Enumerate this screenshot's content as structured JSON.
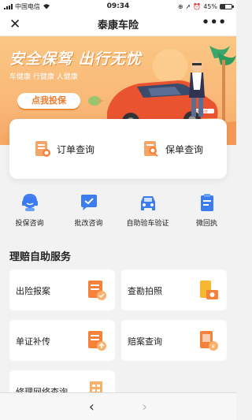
{
  "status_bar": {
    "carrier": "中国电信",
    "time": "09:34",
    "battery": "45%",
    "battery_level": 0.45
  },
  "nav": {
    "close_glyph": "✕",
    "title": "泰康车险",
    "more_glyph": "•••"
  },
  "banner": {
    "title": "安全保驾 出行无忧",
    "subtitle": "车健康  行健康  人健康",
    "cta": "点我投保",
    "car_plate": "保驾无忧"
  },
  "query": [
    {
      "label": "订单查询",
      "icon": "order-doc-icon"
    },
    {
      "label": "保单查询",
      "icon": "policy-search-icon"
    }
  ],
  "quick_services": [
    {
      "label": "投保咨询",
      "icon": "customer-service-icon"
    },
    {
      "label": "批改咨询",
      "icon": "chat-check-icon"
    },
    {
      "label": "自助验车验证",
      "icon": "car-icon"
    },
    {
      "label": "微回执",
      "icon": "clipboard-icon"
    }
  ],
  "section": {
    "title": "理赔自助服务"
  },
  "claims": [
    {
      "label": "出险报案",
      "icon": "report-doc-icon"
    },
    {
      "label": "查勘拍照",
      "icon": "camera-doc-icon"
    },
    {
      "label": "单证补传",
      "icon": "upload-doc-icon"
    },
    {
      "label": "赔案查询",
      "icon": "claim-money-icon"
    },
    {
      "label": "修理网络查询",
      "icon": "building-icon"
    }
  ],
  "bottom": {
    "back_glyph": "‹",
    "forward_glyph": "›"
  },
  "colors": {
    "accent": "#f5813a",
    "banner": "#fbc683",
    "blue": "#3d7bf0"
  }
}
